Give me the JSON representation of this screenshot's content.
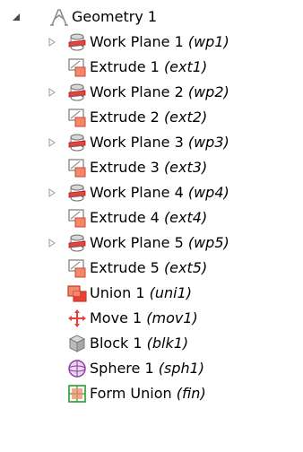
{
  "tree": {
    "root": {
      "label": "Geometry 1",
      "icon": "geometry-icon",
      "expanded": true
    },
    "children": [
      {
        "label": "Work Plane 1",
        "tag": "(wp1)",
        "icon": "work-plane-icon",
        "expandable": true
      },
      {
        "label": "Extrude 1",
        "tag": "(ext1)",
        "icon": "extrude-icon",
        "expandable": false
      },
      {
        "label": "Work Plane 2",
        "tag": "(wp2)",
        "icon": "work-plane-icon",
        "expandable": true
      },
      {
        "label": "Extrude 2",
        "tag": "(ext2)",
        "icon": "extrude-icon",
        "expandable": false
      },
      {
        "label": "Work Plane 3",
        "tag": "(wp3)",
        "icon": "work-plane-icon",
        "expandable": true
      },
      {
        "label": "Extrude 3",
        "tag": "(ext3)",
        "icon": "extrude-icon",
        "expandable": false
      },
      {
        "label": "Work Plane 4",
        "tag": "(wp4)",
        "icon": "work-plane-icon",
        "expandable": true
      },
      {
        "label": "Extrude 4",
        "tag": "(ext4)",
        "icon": "extrude-icon",
        "expandable": false
      },
      {
        "label": "Work Plane 5",
        "tag": "(wp5)",
        "icon": "work-plane-icon",
        "expandable": true
      },
      {
        "label": "Extrude 5",
        "tag": "(ext5)",
        "icon": "extrude-icon",
        "expandable": false
      },
      {
        "label": "Union 1",
        "tag": "(uni1)",
        "icon": "union-icon",
        "expandable": false
      },
      {
        "label": "Move 1",
        "tag": "(mov1)",
        "icon": "move-icon",
        "expandable": false
      },
      {
        "label": "Block 1",
        "tag": "(blk1)",
        "icon": "block-icon",
        "expandable": false
      },
      {
        "label": "Sphere 1",
        "tag": "(sph1)",
        "icon": "sphere-icon",
        "expandable": false
      },
      {
        "label": "Form Union",
        "tag": "(fin)",
        "icon": "form-union-icon",
        "expandable": false
      }
    ]
  },
  "colors": {
    "accent_red": "#e8413a",
    "accent_orange": "#f08a6a",
    "accent_green": "#2a9d2a",
    "icon_gray": "#8a8a8a",
    "block_gray": "#b9b9b9",
    "sphere_purple": "#8a3aa0"
  }
}
